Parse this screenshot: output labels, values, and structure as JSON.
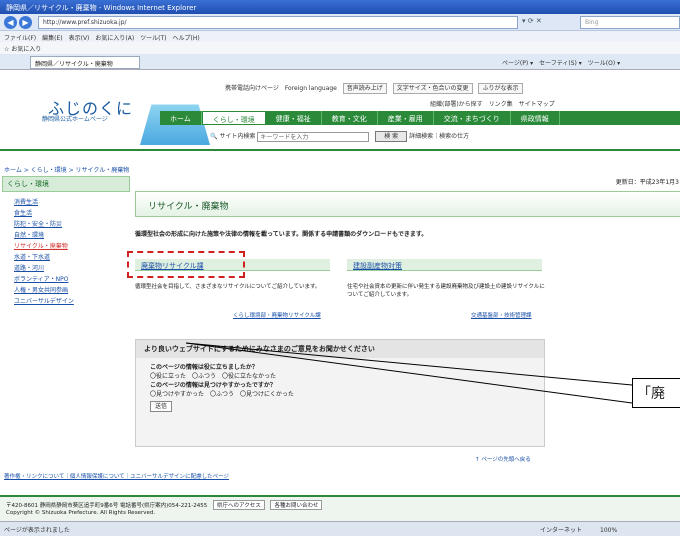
{
  "browser": {
    "title": "静岡県／リサイクル・廃棄物 - Windows Internet Explorer",
    "url": "http://www.pref.shizuoka.jp/",
    "search_placeholder": "Bing",
    "menu": "ファイル(F)　編集(E)　表示(V)　お気に入り(A)　ツール(T)　ヘルプ(H)",
    "favorites": "お気に入り",
    "tab_label": "静岡県／リサイクル・廃棄物",
    "tab_tools": "ページ(P) ▾　セーフティ(S) ▾　ツール(O) ▾",
    "status_left": "ページが表示されました",
    "status_right": "インターネット　　　100%"
  },
  "site": {
    "logo": "ふじのくに",
    "logo_sub": "静岡県公式ホームページ",
    "top_links": [
      "携帯電話向けページ",
      "Foreign language",
      "音声読み上げ",
      "文字サイズ・色合いの変更",
      "ふりがな表示"
    ],
    "sub_links": "組織(部署)から探す　リンク集　サイトマップ",
    "nav": [
      "ホーム",
      "くらし・環境",
      "健康・福祉",
      "教育・文化",
      "産業・雇用",
      "交流・まちづくり",
      "県政情報"
    ],
    "search_label": "サイト内検索",
    "search_placeholder": "キーワードを入力",
    "search_button": "検 索",
    "search_extra": "詳細検索｜検索の仕方"
  },
  "breadcrumb": "ホーム > くらし・環境 > リサイクル・廃棄物",
  "sidebar": {
    "head": "くらし・環境",
    "items": [
      "消費生活",
      "食生活",
      "防犯・安全・防災",
      "自然・環境",
      "リサイクル・廃棄物",
      "水道・下水道",
      "道路・河川",
      "ボランティア・NPO",
      "人権・男女共同参画",
      "ユニバーサルデザイン"
    ]
  },
  "main": {
    "updated": "更新日：平成23年1月3日",
    "title": "リサイクル・廃棄物",
    "intro": "循環型社会の形成に向けた施策や法律の情報を載っています。関係する申請書類のダウンロードもできます。",
    "box1_title": "廃棄物リサイクル課",
    "box1_desc": "循環型社会を目指して、さまざまなリサイクルについてご紹介しています。",
    "box1_link": "くらし環境部・廃棄物リサイクル課",
    "box2_title": "建設副産物対策",
    "box2_desc": "住宅や社会資本の更新に伴い発生する建設廃棄物及び建設土の建設リサイクルについてご紹介しています。",
    "box2_link": "交通基盤部・技術管理課",
    "fb_head": "より良いウェブサイトにするためにみなさまのご意見をお聞かせください",
    "fb_q1": "このページの情報は役に立ちましたか？",
    "fb_a1": "〇役に立った　〇ふつう　〇役に立たなかった",
    "fb_q2": "このページの情報は見つけやすかったですか？",
    "fb_a2": "〇見つけやすかった　〇ふつう　〇見つけにくかった",
    "fb_send": "送信",
    "to_top": "↑ ページの先頭へ戻る"
  },
  "footer": {
    "links": "著作権・リンクについて｜個人情報保護について｜ユニバーサルデザインに配慮したページ",
    "address": "〒420-8601 静岡県静岡市葵区追手町9番6号 電話番号(県庁案内)054-221-2455",
    "access_btn": "県庁へのアクセス",
    "contact_btn": "各種お問い合わせ",
    "copyright": "Copyright © Shizuoka Prefecture. All Rights Reserved."
  },
  "callout": "「廃"
}
